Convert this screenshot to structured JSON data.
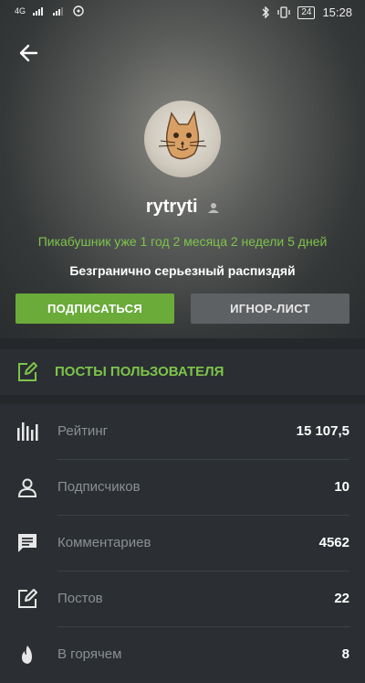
{
  "status_bar": {
    "network1": "4G",
    "time": "15:28",
    "battery": "24"
  },
  "profile": {
    "username": "rytryti",
    "since": "Пикабушник уже 1 год 2 месяца 2 недели 5 дней",
    "bio": "Безгранично серьезный распиздяй"
  },
  "buttons": {
    "subscribe": "ПОДПИСАТЬСЯ",
    "ignore": "ИГНОР-ЛИСТ"
  },
  "posts_link": "ПОСТЫ ПОЛЬЗОВАТЕЛЯ",
  "stats": [
    {
      "label": "Рейтинг",
      "value": "15 107,5",
      "icon": "bar-chart-icon"
    },
    {
      "label": "Подписчиков",
      "value": "10",
      "icon": "person-icon"
    },
    {
      "label": "Комментариев",
      "value": "4562",
      "icon": "comment-icon"
    },
    {
      "label": "Постов",
      "value": "22",
      "icon": "edit-icon"
    },
    {
      "label": "В горячем",
      "value": "8",
      "icon": "fire-icon"
    }
  ],
  "colors": {
    "accent": "#7dc44a",
    "subscribe_bg": "#6aab3a",
    "background": "#2b2f33"
  }
}
